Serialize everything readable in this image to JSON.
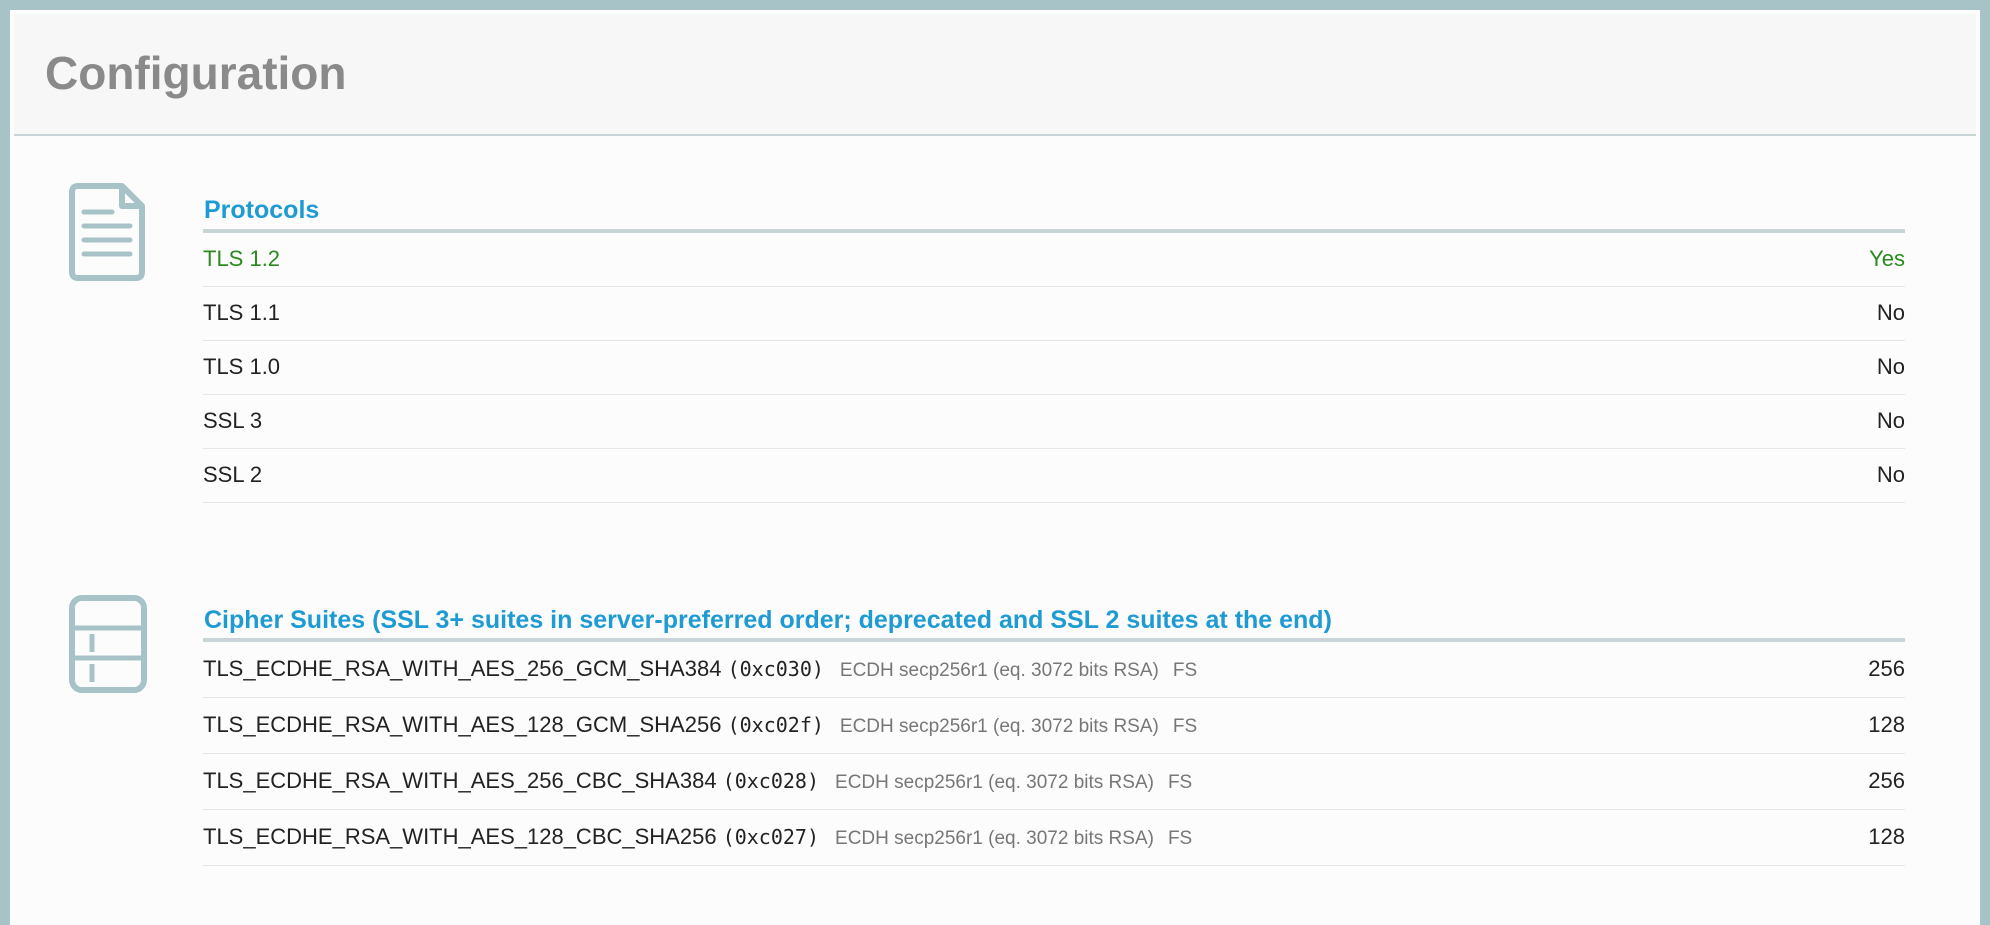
{
  "header": {
    "title": "Configuration"
  },
  "protocols": {
    "title": "Protocols",
    "icon": "document-icon",
    "rows": [
      {
        "name": "TLS 1.2",
        "value": "Yes",
        "ok": true
      },
      {
        "name": "TLS 1.1",
        "value": "No",
        "ok": false
      },
      {
        "name": "TLS 1.0",
        "value": "No",
        "ok": false
      },
      {
        "name": "SSL 3",
        "value": "No",
        "ok": false
      },
      {
        "name": "SSL 2",
        "value": "No",
        "ok": false
      }
    ]
  },
  "ciphers": {
    "title": "Cipher Suites (SSL 3+ suites in server-preferred order; deprecated and SSL 2 suites at the end)",
    "icon": "table-icon",
    "rows": [
      {
        "name": "TLS_ECDHE_RSA_WITH_AES_256_GCM_SHA384",
        "code": "(0xc030)",
        "kx": "ECDH secp256r1 (eq. 3072 bits RSA)",
        "fs": "FS",
        "bits": "256"
      },
      {
        "name": "TLS_ECDHE_RSA_WITH_AES_128_GCM_SHA256",
        "code": "(0xc02f)",
        "kx": "ECDH secp256r1 (eq. 3072 bits RSA)",
        "fs": "FS",
        "bits": "128"
      },
      {
        "name": "TLS_ECDHE_RSA_WITH_AES_256_CBC_SHA384",
        "code": "(0xc028)",
        "kx": "ECDH secp256r1 (eq. 3072 bits RSA)",
        "fs": "FS",
        "bits": "256"
      },
      {
        "name": "TLS_ECDHE_RSA_WITH_AES_128_CBC_SHA256",
        "code": "(0xc027)",
        "kx": "ECDH secp256r1 (eq. 3072 bits RSA)",
        "fs": "FS",
        "bits": "128"
      }
    ]
  },
  "colors": {
    "frame": "#a8c3c8",
    "heading": "#1f9bd3",
    "ok": "#2a8a1f",
    "title_gray": "#8a8a8a"
  }
}
